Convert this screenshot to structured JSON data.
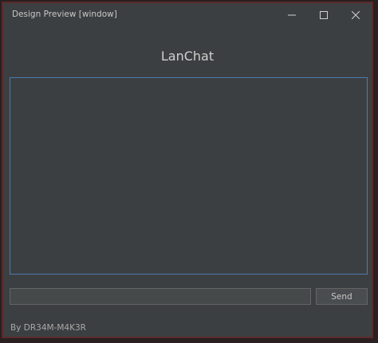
{
  "window": {
    "title": "Design Preview [window]",
    "controls": {
      "minimize_icon": "minimize-icon",
      "maximize_icon": "maximize-icon",
      "close_icon": "close-icon"
    }
  },
  "app": {
    "title": "LanChat"
  },
  "chat": {
    "messages": []
  },
  "composer": {
    "input_value": "",
    "send_label": "Send"
  },
  "footer": {
    "credit": "By DR34M-M4K3R"
  },
  "colors": {
    "background": "#3c3f41",
    "focus_border": "#4a7bb0",
    "text": "#d0d0d0"
  }
}
